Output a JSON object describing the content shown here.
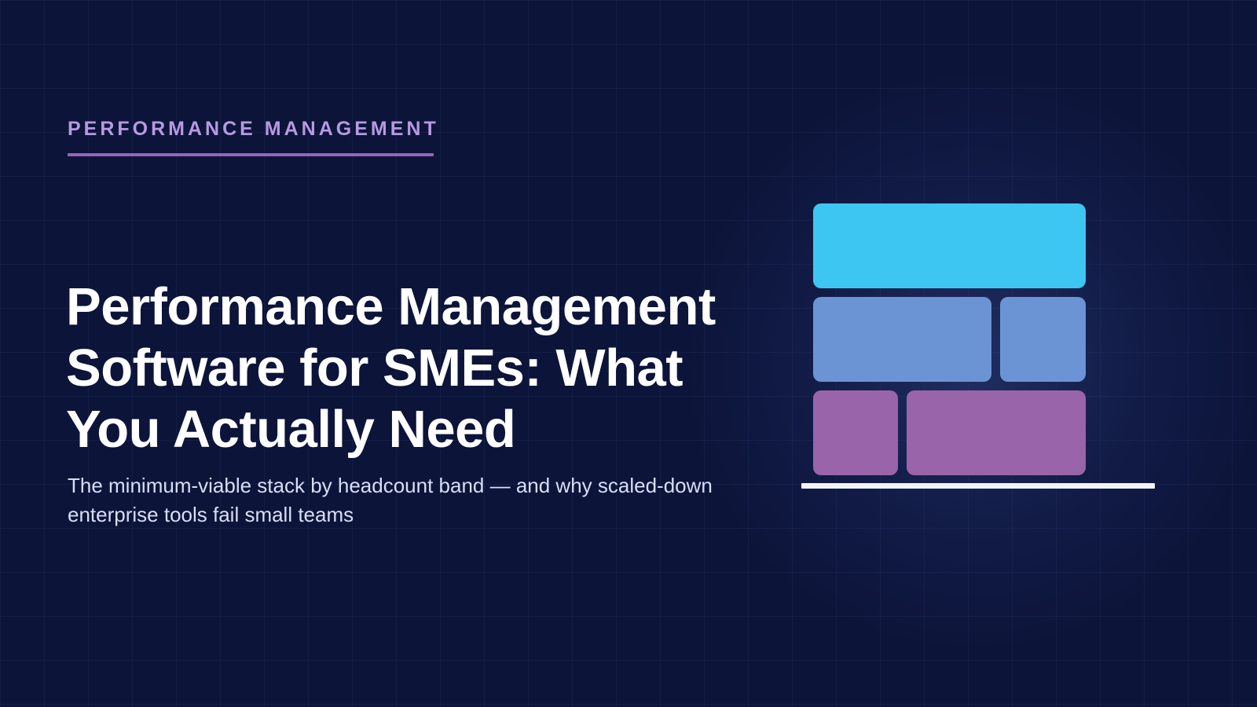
{
  "eyebrow": "PERFORMANCE MANAGEMENT",
  "headline": "Performance Management Software for SMEs: What You Actually Need",
  "subtitle": "The minimum-viable stack by headcount band — and why scaled-down enterprise tools fail small teams",
  "colors": {
    "background": "#0c1439",
    "eyebrow": "#b79ae0",
    "eyebrow_underline": "#9a63b8",
    "block_top": "#3ec6f2",
    "block_middle": "#6b94d4",
    "block_bottom": "#9a64ab",
    "baseline": "#f1f3fb"
  },
  "illustration": {
    "icon": "stacked-blocks-icon"
  }
}
